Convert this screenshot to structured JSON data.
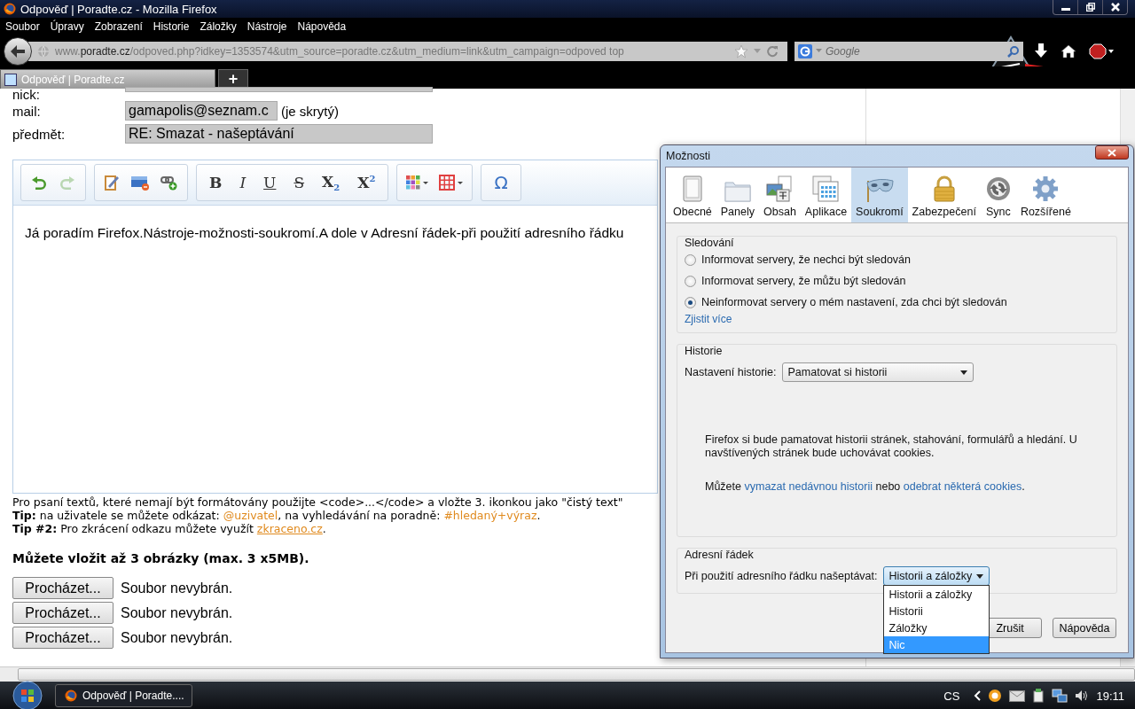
{
  "window": {
    "title": "Odpověď | Poradte.cz - Mozilla Firefox"
  },
  "menu": [
    "Soubor",
    "Úpravy",
    "Zobrazení",
    "Historie",
    "Záložky",
    "Nástroje",
    "Nápověda"
  ],
  "address_bar": {
    "url": "www.**poradte.cz**/odpoved.php?idkey=1353574&utm_source=poradte.cz&utm_medium=link&utm_campaign=odpoved top"
  },
  "search": {
    "placeholder": "Google"
  },
  "tabs": [
    {
      "label": "Odpověď | Poradte.cz",
      "selected": true
    }
  ],
  "new_tab": "+",
  "form": {
    "fields": [
      {
        "label": "nick:"
      },
      {
        "label": "mail:",
        "value": "gamapolis@seznam.c",
        "note": "(je skrytý)"
      },
      {
        "label": "předmět:",
        "value": "RE: Smazat - našeptávání"
      }
    ]
  },
  "editor": {
    "toolbar": [
      [
        {
          "kind": "undo",
          "disabled": false
        },
        {
          "kind": "redo",
          "disabled": true
        }
      ],
      [
        {
          "kind": "paste-text"
        },
        {
          "kind": "html"
        },
        {
          "kind": "link"
        }
      ],
      [
        {
          "kind": "bold",
          "label": "B"
        },
        {
          "kind": "italic",
          "label": "I"
        },
        {
          "kind": "underline",
          "label": "U"
        },
        {
          "kind": "strike",
          "label": "S"
        },
        {
          "kind": "sub",
          "label": "X$_{2}$"
        },
        {
          "kind": "sup",
          "label": "X$^{2}$"
        }
      ],
      [
        {
          "kind": "colors"
        },
        {
          "kind": "table"
        }
      ],
      [
        {
          "kind": "symbol",
          "label": "Ω"
        }
      ]
    ],
    "text": "Já poradím Firefox.Nástroje-možnosti-soukromí.A dole v Adresní řádek-při použití adresního řádku"
  },
  "hints": [
    [
      {
        "kind": "text",
        "text": "Pro psaní textů, které nemají být formátovány použijte <code>...</code> a vložte 3. ikonkou jako \"čistý text\""
      }
    ],
    [
      {
        "kind": "text",
        "text": "**Tip:** na uživatele se můžete odkázat: "
      },
      {
        "kind": "link",
        "text": "@uzivatel"
      },
      {
        "kind": "text",
        "text": ", na vyhledávání na poradně: "
      },
      {
        "kind": "link",
        "text": "#hledaný+výraz"
      },
      {
        "kind": "text",
        "text": "."
      }
    ],
    [
      {
        "kind": "text",
        "text": "**Tip #2:** Pro zkrácení odkazu můžete využít "
      },
      {
        "kind": "underlined-link",
        "text": "zkraceno.cz"
      },
      {
        "kind": "text",
        "text": "."
      }
    ]
  ],
  "upload": {
    "heading": "Můžete vložit až 3 obrázky (max. 3 x5MB).",
    "files": [
      {
        "button": "Procházet...",
        "status": "Soubor nevybrán."
      },
      {
        "button": "Procházet...",
        "status": "Soubor nevybrán."
      },
      {
        "button": "Procházet...",
        "status": "Soubor nevybrán."
      }
    ]
  },
  "dialog": {
    "title": "Možnosti",
    "panes": [
      {
        "label": "Obecné",
        "kind": "general",
        "selected": false
      },
      {
        "label": "Panely",
        "kind": "tabs",
        "selected": false
      },
      {
        "label": "Obsah",
        "kind": "content",
        "selected": false
      },
      {
        "label": "Aplikace",
        "kind": "applications",
        "selected": false
      },
      {
        "label": "Soukromí",
        "kind": "privacy",
        "selected": true
      },
      {
        "label": "Zabezpečení",
        "kind": "security",
        "selected": false
      },
      {
        "label": "Sync",
        "kind": "sync",
        "selected": false
      },
      {
        "label": "Rozšířené",
        "kind": "advanced",
        "selected": false
      }
    ],
    "tracking": {
      "legend": "Sledování",
      "options": [
        {
          "label": "Informovat servery, že nechci být sledován",
          "selected": false
        },
        {
          "label": "Informovat servery, že můžu být sledován",
          "selected": false
        },
        {
          "label": "Neinformovat servery o mém nastavení, zda chci být sledován",
          "selected": true
        }
      ],
      "link": "Zjistit více"
    },
    "history": {
      "legend": "Historie",
      "label": "Nastavení historie:",
      "value": "Pamatovat si historii",
      "description": "Firefox si bude pamatovat historii stránek, stahování, formulářů a hledání. U navštívených stránek bude uchovávat cookies.",
      "actions": [
        {
          "kind": "text",
          "text": "Můžete "
        },
        {
          "kind": "link",
          "text": "vymazat nedávnou historii"
        },
        {
          "kind": "text",
          "text": " nebo "
        },
        {
          "kind": "link",
          "text": "odebrat některá cookies"
        },
        {
          "kind": "text",
          "text": "."
        }
      ]
    },
    "location_bar": {
      "legend": "Adresní řádek",
      "label": "Při použití adresního řádku našeptávat:",
      "value": "Historii a záložky",
      "expanded": true,
      "options": [
        {
          "label": "Historii a záložky",
          "highlighted": false
        },
        {
          "label": "Historii",
          "highlighted": false
        },
        {
          "label": "Záložky",
          "highlighted": false
        },
        {
          "label": "Nic",
          "highlighted": true
        }
      ]
    },
    "buttons": [
      "Zrušit",
      "Nápověda"
    ]
  },
  "taskbar": {
    "tasks": [
      {
        "label": "Odpověď | Poradte...."
      }
    ],
    "language": "CS",
    "clock": "19:11"
  }
}
